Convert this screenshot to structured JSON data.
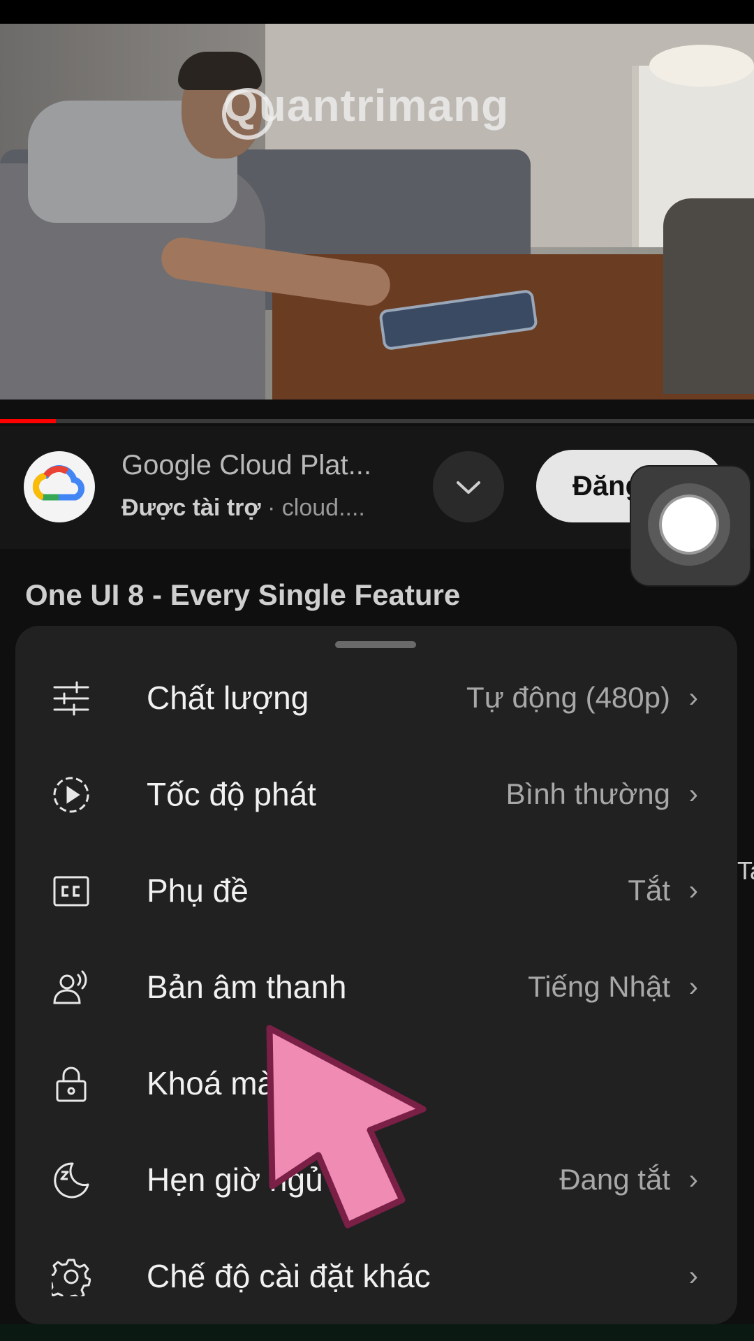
{
  "watermark": "Quantrimang",
  "sponsor": {
    "name": "Google Cloud Plat...",
    "sponsored_label": "Được tài trợ",
    "separator": "·",
    "domain": "cloud....",
    "subscribe_label": "Đăng"
  },
  "video": {
    "title": "One UI 8 - Every Single Feature"
  },
  "edge_text": "Ta",
  "settings_menu": {
    "items": [
      {
        "label": "Chất lượng",
        "value": "Tự động (480p)",
        "icon": "sliders-icon"
      },
      {
        "label": "Tốc độ phát",
        "value": "Bình thường",
        "icon": "playback-speed-icon"
      },
      {
        "label": "Phụ đề",
        "value": "Tắt",
        "icon": "cc-icon"
      },
      {
        "label": "Bản âm thanh",
        "value": "Tiếng Nhật",
        "icon": "audio-track-icon"
      },
      {
        "label": "Khoá màn hình",
        "value": "",
        "icon": "lock-icon"
      },
      {
        "label": "Hẹn giờ ngủ",
        "value": "Đang tắt",
        "icon": "sleep-timer-icon"
      },
      {
        "label": "Chế độ cài đặt khác",
        "value": "",
        "icon": "gear-icon"
      }
    ],
    "chevron": "›"
  },
  "colors": {
    "sheet_bg": "#212121",
    "pointer_fill": "#f08cb4",
    "pointer_stroke": "#7a1f45",
    "progress": "#ff0000"
  }
}
